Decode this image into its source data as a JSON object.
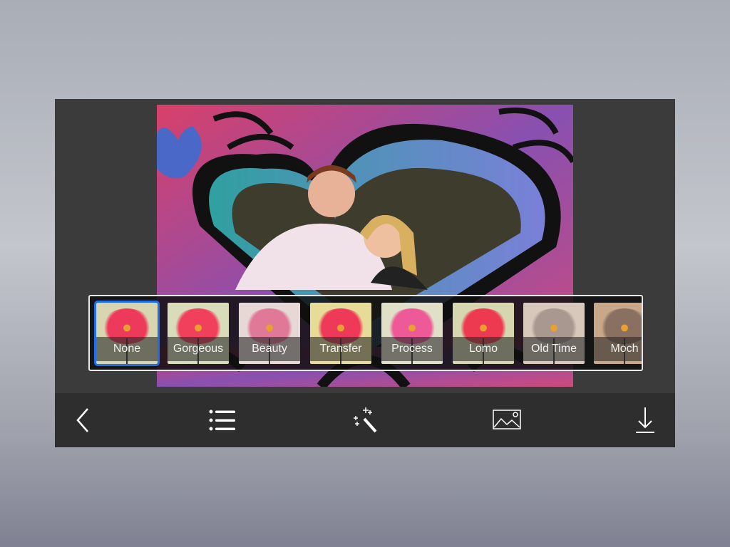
{
  "filters": [
    {
      "label": "None",
      "bg": "#d8d6b0",
      "flower": "#ee3a5a",
      "selected": true
    },
    {
      "label": "Gorgeous",
      "bg": "#d8dcb8",
      "flower": "#f0405c",
      "selected": false
    },
    {
      "label": "Beauty",
      "bg": "#e6d8d4",
      "flower": "#e07898",
      "selected": false
    },
    {
      "label": "Transfer",
      "bg": "#e6dc98",
      "flower": "#ee3a58",
      "selected": false
    },
    {
      "label": "Process",
      "bg": "#e0e0c8",
      "flower": "#ee5a98",
      "selected": false
    },
    {
      "label": "Lomo",
      "bg": "#d6d6b0",
      "flower": "#ee3a50",
      "selected": false
    },
    {
      "label": "Old Time",
      "bg": "#d8c8bc",
      "flower": "#a89890",
      "selected": false
    },
    {
      "label": "Moch",
      "bg": "#c8a888",
      "flower": "#8a7060",
      "selected": false
    }
  ],
  "toolbar": [
    "back-icon",
    "list-icon",
    "magic-wand-icon",
    "image-icon",
    "download-icon"
  ],
  "colors": {
    "accent": "#1e6ff0",
    "panel": "#3b3b3b",
    "toolbar": "#2e2e2e"
  }
}
